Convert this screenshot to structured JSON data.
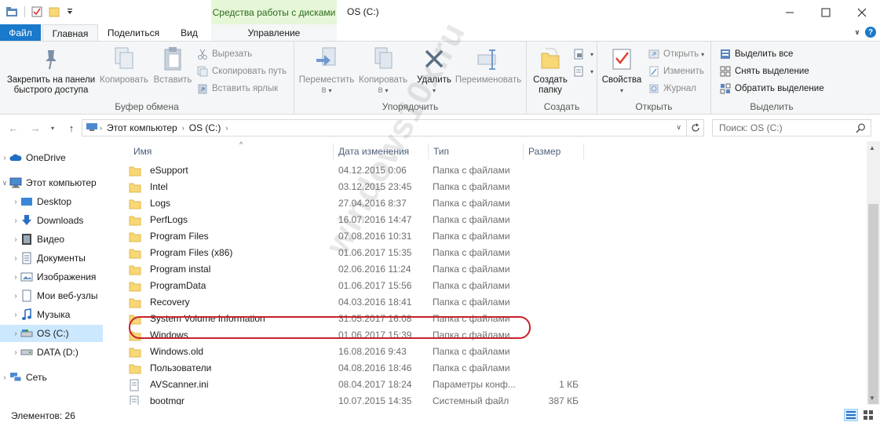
{
  "titlebar": {
    "context_header": "Средства работы с дисками",
    "window_title": "OS (C:)"
  },
  "tabs": {
    "file": "Файл",
    "home": "Главная",
    "share": "Поделиться",
    "view": "Вид",
    "manage": "Управление"
  },
  "ribbon": {
    "clipboard": {
      "label": "Буфер обмена",
      "pin": "Закрепить на панели быстрого доступа",
      "pin_line1": "Закрепить на панели",
      "pin_line2": "быстрого доступа",
      "copy": "Копировать",
      "paste": "Вставить",
      "cut": "Вырезать",
      "copy_path": "Скопировать путь",
      "paste_shortcut": "Вставить ярлык"
    },
    "organize": {
      "label": "Упорядочить",
      "move_to_line1": "Переместить",
      "move_to_line2": "в",
      "copy_to_line1": "Копировать",
      "copy_to_line2": "в",
      "delete": "Удалить",
      "rename": "Переименовать"
    },
    "create": {
      "label": "Создать",
      "new_folder_line1": "Создать",
      "new_folder_line2": "папку"
    },
    "open": {
      "label": "Открыть",
      "properties": "Свойства",
      "open": "Открыть",
      "edit": "Изменить",
      "history": "Журнал"
    },
    "select": {
      "label": "Выделить",
      "select_all": "Выделить все",
      "select_none": "Снять выделение",
      "invert": "Обратить выделение"
    }
  },
  "address": {
    "crumbs": [
      "Этот компьютер",
      "OS (C:)"
    ],
    "search_placeholder": "Поиск: OS (C:)"
  },
  "navpane": {
    "items": [
      {
        "label": "OneDrive",
        "icon": "cloud-icon"
      },
      {
        "label": "Этот компьютер",
        "icon": "computer-icon"
      },
      {
        "label": "Desktop",
        "icon": "desktop-icon"
      },
      {
        "label": "Downloads",
        "icon": "downloads-icon"
      },
      {
        "label": "Видео",
        "icon": "video-icon"
      },
      {
        "label": "Документы",
        "icon": "documents-icon"
      },
      {
        "label": "Изображения",
        "icon": "pictures-icon"
      },
      {
        "label": "Мои веб-узлы",
        "icon": "web-icon"
      },
      {
        "label": "Музыка",
        "icon": "music-icon"
      },
      {
        "label": "OS (C:)",
        "icon": "drive-icon"
      },
      {
        "label": "DATA (D:)",
        "icon": "drive-icon"
      },
      {
        "label": "Сеть",
        "icon": "network-icon"
      }
    ]
  },
  "columns": {
    "name": "Имя",
    "date": "Дата изменения",
    "type": "Тип",
    "size": "Размер"
  },
  "files": [
    {
      "name": "eSupport",
      "date": "04.12.2015 0:06",
      "type": "Папка с файлами",
      "size": ""
    },
    {
      "name": "Intel",
      "date": "03.12.2015 23:45",
      "type": "Папка с файлами",
      "size": ""
    },
    {
      "name": "Logs",
      "date": "27.04.2016 8:37",
      "type": "Папка с файлами",
      "size": ""
    },
    {
      "name": "PerfLogs",
      "date": "16.07.2016 14:47",
      "type": "Папка с файлами",
      "size": ""
    },
    {
      "name": "Program Files",
      "date": "07.08.2016 10:31",
      "type": "Папка с файлами",
      "size": ""
    },
    {
      "name": "Program Files (x86)",
      "date": "01.06.2017 15:35",
      "type": "Папка с файлами",
      "size": ""
    },
    {
      "name": "Program instal",
      "date": "02.06.2016 11:24",
      "type": "Папка с файлами",
      "size": ""
    },
    {
      "name": "ProgramData",
      "date": "01.06.2017 15:56",
      "type": "Папка с файлами",
      "size": ""
    },
    {
      "name": "Recovery",
      "date": "04.03.2016 18:41",
      "type": "Папка с файлами",
      "size": ""
    },
    {
      "name": "System Volume Information",
      "date": "31.05.2017 16:08",
      "type": "Папка с файлами",
      "size": ""
    },
    {
      "name": "Windows",
      "date": "01.06.2017 15:39",
      "type": "Папка с файлами",
      "size": ""
    },
    {
      "name": "Windows.old",
      "date": "16.08.2016 9:43",
      "type": "Папка с файлами",
      "size": ""
    },
    {
      "name": "Пользователи",
      "date": "04.08.2016 18:46",
      "type": "Папка с файлами",
      "size": ""
    },
    {
      "name": "AVScanner.ini",
      "date": "08.04.2017 18:24",
      "type": "Параметры конф...",
      "size": "1 КБ"
    },
    {
      "name": "bootmgr",
      "date": "10.07.2015 14:35",
      "type": "Системный файл",
      "size": "387 КБ"
    }
  ],
  "status": {
    "count": "Элементов: 26"
  },
  "watermark": "windows10x.ru"
}
